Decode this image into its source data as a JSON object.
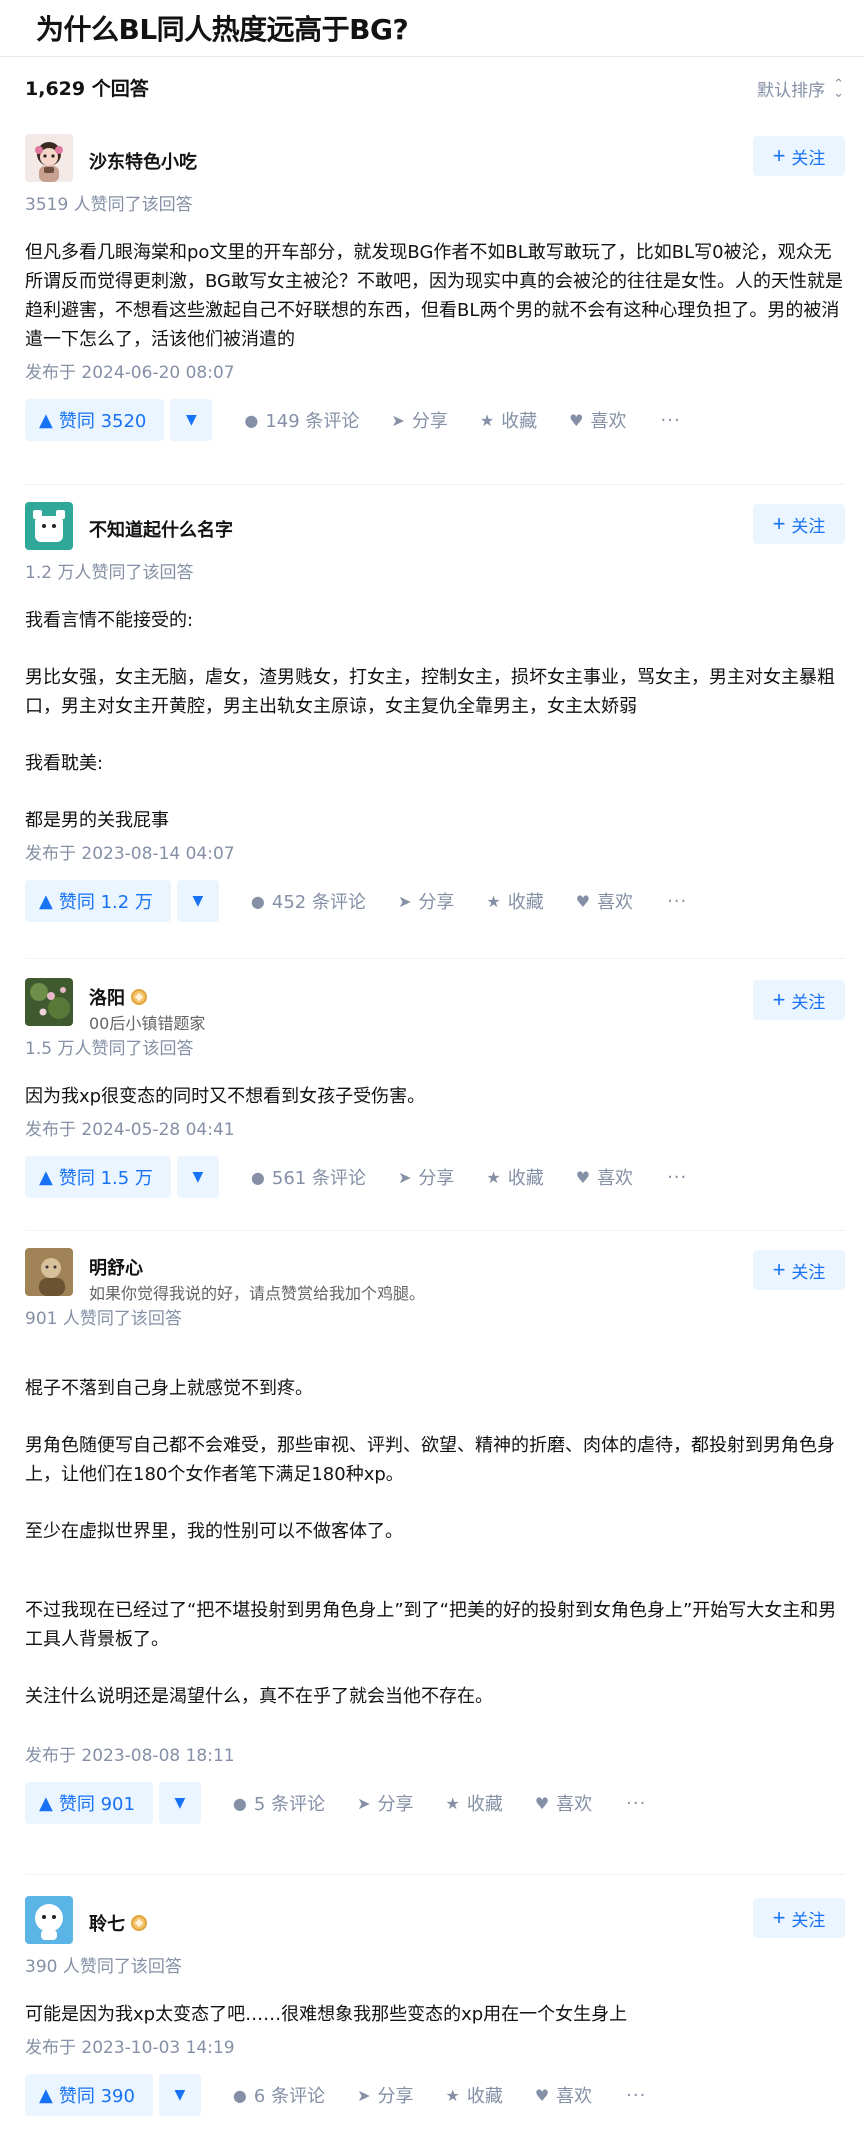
{
  "question": {
    "title": "为什么BL同人热度远高于BG?",
    "answer_count": "1,629 个回答",
    "sort_label": "默认排序"
  },
  "follow_label": "关注",
  "answers": [
    {
      "author": "沙东特色小吃",
      "bio": "",
      "votes_text": "3519 人赞同了该回答",
      "paragraphs": [
        "但凡多看几眼海棠和po文里的开车部分，就发现BG作者不如BL敢写敢玩了，比如BL写0被沦，观众无所谓反而觉得更刺激，BG敢写女主被沦？不敢吧，因为现实中真的会被沦的往往是女性。人的天性就是趋利避害，不想看这些激起自己不好联想的东西，但看BL两个男的就不会有这种心理负担了。男的被消遣一下怎么了，活该他们被消遣的"
      ],
      "date": "发布于 2024-06-20 08:07",
      "vote_label": "赞同 3520",
      "comments": "149 条评论",
      "share": "分享",
      "collect": "收藏",
      "like": "喜欢",
      "more": "···"
    },
    {
      "author": "不知道起什么名字",
      "bio": "",
      "votes_text": "1.2 万人赞同了该回答",
      "paragraphs": [
        "我看言情不能接受的:",
        "男比女强，女主无脑，虐女，渣男贱女，打女主，控制女主，损坏女主事业，骂女主，男主对女主暴粗口，男主对女主开黄腔，男主出轨女主原谅，女主复仇全靠男主，女主太娇弱",
        "我看耽美:",
        "都是男的关我屁事"
      ],
      "date": "发布于 2023-08-14 04:07",
      "vote_label": "赞同 1.2 万",
      "comments": "452 条评论",
      "share": "分享",
      "collect": "收藏",
      "like": "喜欢",
      "more": "···"
    },
    {
      "author": "洛阳",
      "bio": "00后小镇错题家",
      "votes_text": "1.5 万人赞同了该回答",
      "paragraphs": [
        "因为我xp很变态的同时又不想看到女孩子受伤害。"
      ],
      "date": "发布于 2024-05-28 04:41",
      "vote_label": "赞同 1.5 万",
      "comments": "561 条评论",
      "share": "分享",
      "collect": "收藏",
      "like": "喜欢",
      "more": "···"
    },
    {
      "author": "明舒心",
      "bio": "如果你觉得我说的好，请点赞赏给我加个鸡腿。",
      "votes_text": "901 人赞同了该回答",
      "paragraphs": [
        "棍子不落到自己身上就感觉不到疼。",
        "男角色随便写自己都不会难受，那些审视、评判、欲望、精神的折磨、肉体的虐待，都投射到男角色身上，让他们在180个女作者笔下满足180种xp。",
        "至少在虚拟世界里，我的性别可以不做客体了。",
        "不过我现在已经过了“把不堪投射到男角色身上”到了“把美的好的投射到女角色身上”开始写大女主和男工具人背景板了。",
        "关注什么说明还是渴望什么，真不在乎了就会当他不存在。"
      ],
      "date": "发布于 2023-08-08 18:11",
      "vote_label": "赞同 901",
      "comments": "5 条评论",
      "share": "分享",
      "collect": "收藏",
      "like": "喜欢",
      "more": "···"
    },
    {
      "author": "聆七",
      "bio": "",
      "votes_text": "390 人赞同了该回答",
      "paragraphs": [
        "可能是因为我xp太变态了吧……很难想象我那些变态的xp用在一个女生身上"
      ],
      "date": "发布于 2023-10-03 14:19",
      "vote_label": "赞同 390",
      "comments": "6 条评论",
      "share": "分享",
      "collect": "收藏",
      "like": "喜欢",
      "more": "···"
    }
  ],
  "colors": {
    "accent": "#1772f6",
    "accent_bg": "#ebf5ff",
    "muted": "#8590a6",
    "text": "#121212"
  }
}
